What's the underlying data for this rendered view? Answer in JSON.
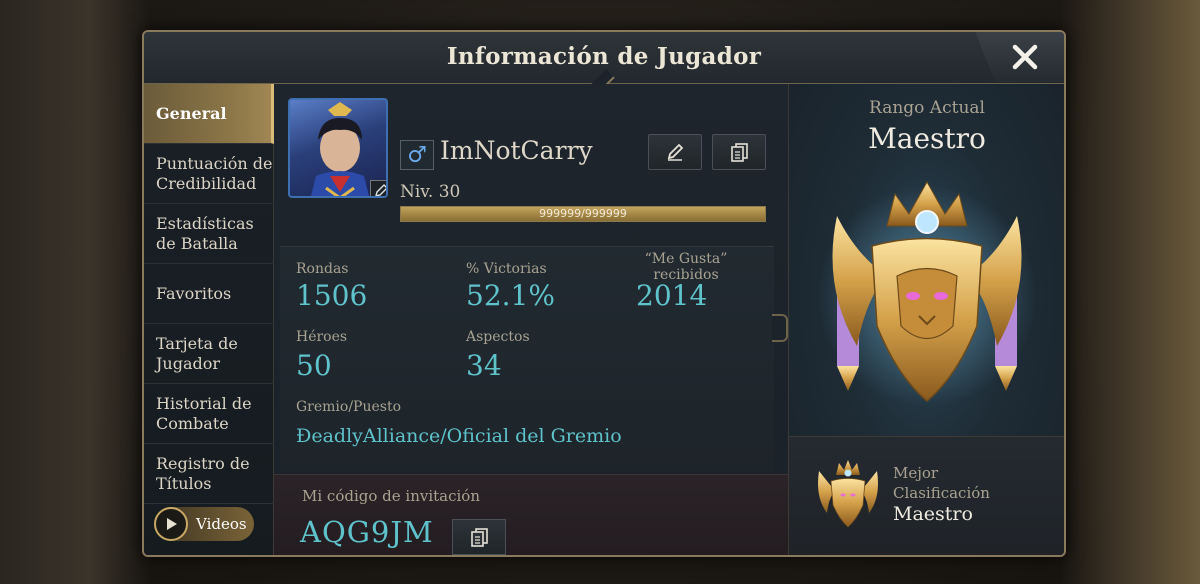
{
  "window": {
    "title": "Información de Jugador"
  },
  "nav": {
    "items": [
      {
        "label": "General",
        "active": true
      },
      {
        "label": "Puntuación de Credibilidad",
        "active": false
      },
      {
        "label": "Estadísticas de Batalla",
        "active": false
      },
      {
        "label": "Favoritos",
        "active": false
      },
      {
        "label": "Tarjeta de Jugador",
        "active": false
      },
      {
        "label": "Historial de Combate",
        "active": false
      },
      {
        "label": "Registro de Títulos",
        "active": false
      }
    ],
    "videos_label": "Videos"
  },
  "profile": {
    "gender_symbol": "♂",
    "name": "ImNotCarry",
    "level_text": "Niv. 30",
    "xp_text": "999999/999999",
    "xp_fraction": 1.0
  },
  "stats": {
    "rounds_label": "Rondas",
    "rounds_value": "1506",
    "winrate_label": "% Victorias",
    "winrate_value": "52.1%",
    "likes_label_1": "“Me Gusta”",
    "likes_label_2": "recibidos",
    "likes_value": "2014",
    "heroes_label": "Héroes",
    "heroes_value": "50",
    "skins_label": "Aspectos",
    "skins_value": "34",
    "guild_label": "Gremio/Puesto",
    "guild_value": "ÐeadlyAlliance/Oficial del Gremio"
  },
  "invite": {
    "label": "Mi código de invitación",
    "code": "AQG9JM"
  },
  "rank": {
    "current_label": "Rango Actual",
    "current_value": "Maestro",
    "best_label": "Mejor Clasificación",
    "best_value": "Maestro"
  },
  "colors": {
    "accent_gold": "#c2a35c",
    "stat_cyan": "#5fc3cc",
    "gender_blue": "#6aa8e8"
  },
  "icons": {
    "close": "close-icon",
    "edit": "pencil-icon",
    "copy": "copy-icon",
    "play": "play-icon",
    "emblem": "master-rank-emblem"
  }
}
